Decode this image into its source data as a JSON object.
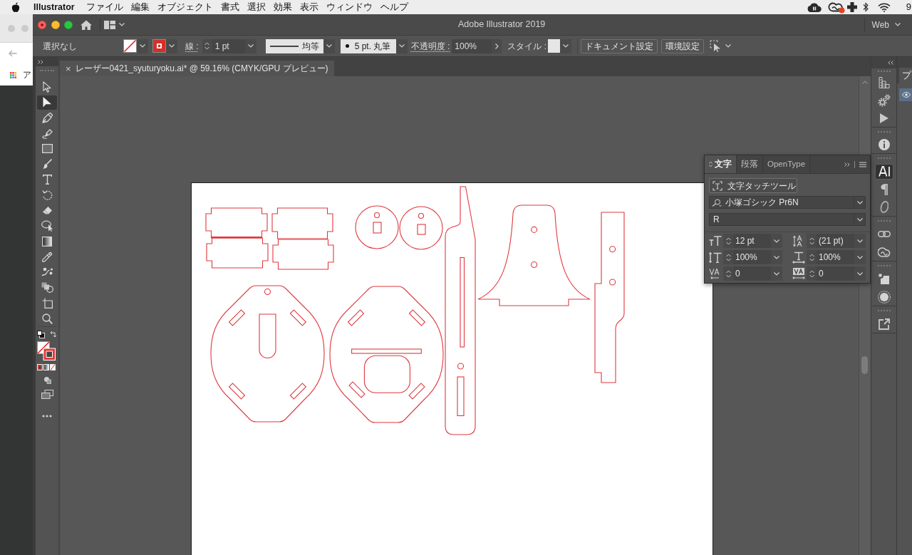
{
  "menu_bar": {
    "app_name": "Illustrator",
    "menus": [
      "ファイル",
      "編集",
      "オブジェクト",
      "書式",
      "選択",
      "効果",
      "表示",
      "ウィンドウ",
      "ヘルプ"
    ],
    "status_text": "9"
  },
  "background_window": {
    "text": "ア"
  },
  "window": {
    "title": "Adobe Illustrator 2019",
    "workspace": "Web"
  },
  "control_bar": {
    "selection": "選択なし",
    "stroke_label": "線 :",
    "stroke_weight": "1 pt",
    "stroke_profile": "均等",
    "brush": "5 pt. 丸筆",
    "opacity_label": "不透明度 :",
    "opacity": "100%",
    "style_label": "スタイル :",
    "buttons": [
      "ドキュメント設定",
      "環境設定"
    ]
  },
  "document_tab": {
    "close": "×",
    "title": "レーザー0421_syuturyoku.ai* @ 59.16% (CMYK/GPU プレビュー)"
  },
  "tools": [
    {
      "kind": "selection",
      "selected": false
    },
    {
      "kind": "direct-selection",
      "selected": true
    },
    {
      "kind": "pen",
      "selected": false
    },
    {
      "kind": "curvature",
      "selected": false
    },
    {
      "kind": "rectangle",
      "selected": false
    },
    {
      "kind": "paintbrush",
      "selected": false
    },
    {
      "kind": "type",
      "selected": false
    },
    {
      "kind": "rotate",
      "selected": false
    },
    {
      "kind": "eraser",
      "selected": false
    },
    {
      "kind": "shape-builder",
      "selected": false
    },
    {
      "kind": "gradient",
      "selected": false
    },
    {
      "kind": "eyedropper",
      "selected": false
    },
    {
      "kind": "puppet-warp",
      "selected": false
    },
    {
      "kind": "blend",
      "selected": false
    },
    {
      "kind": "artboard",
      "selected": false
    },
    {
      "kind": "zoom",
      "selected": false
    }
  ],
  "character_panel": {
    "tabs": [
      {
        "label": "文字",
        "selected": true
      },
      {
        "label": "段落",
        "selected": false
      },
      {
        "label": "OpenType",
        "selected": false
      }
    ],
    "touch_tool": "文字タッチツール",
    "font_family": "小塚ゴシック Pr6N",
    "font_style": "R",
    "fields": [
      {
        "kind": "font-size",
        "value": "12 pt"
      },
      {
        "kind": "leading",
        "value": "(21 pt)"
      },
      {
        "kind": "vertical-scale",
        "value": "100%"
      },
      {
        "kind": "horizontal-scale",
        "value": "100%"
      },
      {
        "kind": "kerning",
        "value": "0"
      },
      {
        "kind": "tracking",
        "value": "0"
      }
    ]
  },
  "right_dock": {
    "groups": [
      {
        "items": [
          {
            "kind": "grid-steps",
            "selected": false
          },
          {
            "kind": "gears",
            "selected": false
          },
          {
            "kind": "play",
            "selected": false
          }
        ]
      },
      {
        "items": [
          {
            "kind": "info",
            "selected": false
          }
        ]
      },
      {
        "items": [
          {
            "kind": "character",
            "selected": true
          },
          {
            "kind": "paragraph",
            "selected": false
          },
          {
            "kind": "opentype",
            "selected": false
          }
        ]
      },
      {
        "items": [
          {
            "kind": "links",
            "selected": false
          },
          {
            "kind": "libraries",
            "selected": false
          }
        ]
      },
      {
        "items": [
          {
            "kind": "shape-corner",
            "selected": false
          },
          {
            "kind": "sun",
            "selected": false
          }
        ]
      },
      {
        "items": [
          {
            "kind": "export",
            "selected": false
          }
        ]
      }
    ]
  },
  "side_panel": {
    "tab_label": "プ"
  }
}
